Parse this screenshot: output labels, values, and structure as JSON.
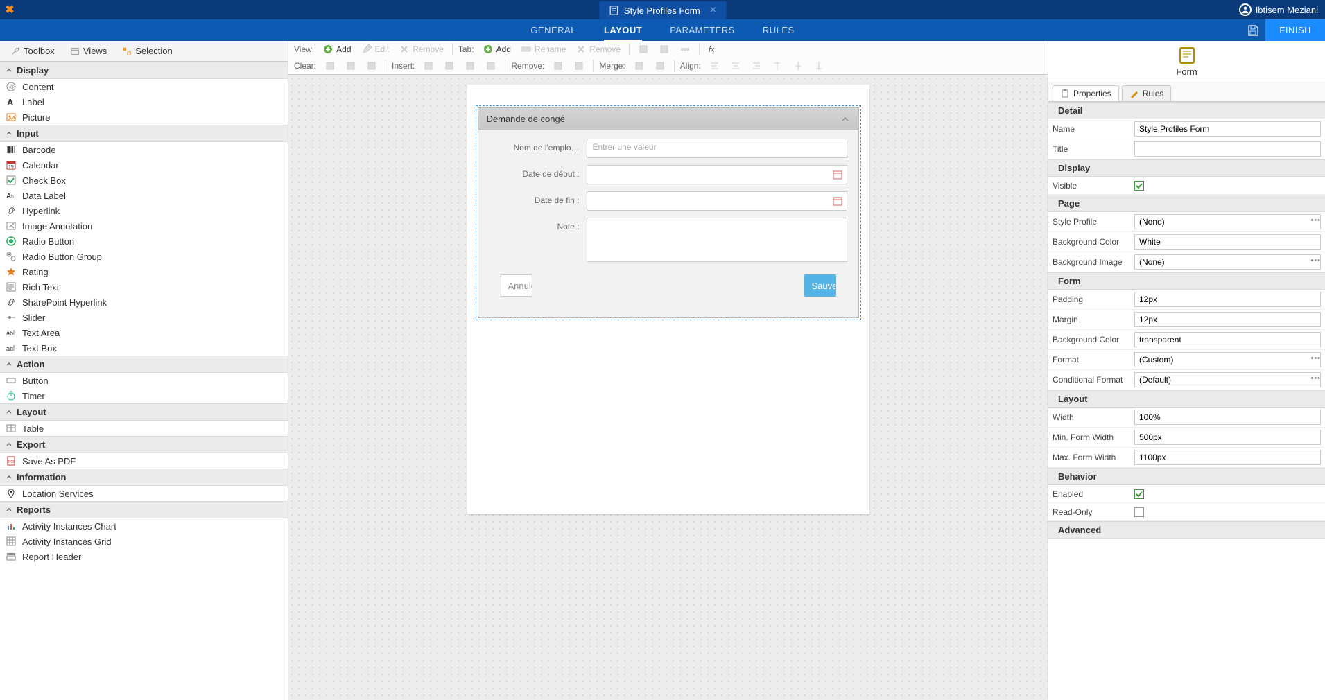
{
  "app": {
    "tab_title": "Style Profiles Form",
    "user_name": "Ibtisem Meziani"
  },
  "nav": {
    "items": [
      "GENERAL",
      "LAYOUT",
      "PARAMETERS",
      "RULES"
    ],
    "active": "LAYOUT",
    "finish": "FINISH"
  },
  "sidebar_tabs": {
    "toolbox": "Toolbox",
    "views": "Views",
    "selection": "Selection"
  },
  "toolbox": {
    "categories": [
      {
        "name": "Display",
        "items": [
          "Content",
          "Label",
          "Picture"
        ]
      },
      {
        "name": "Input",
        "items": [
          "Barcode",
          "Calendar",
          "Check Box",
          "Data Label",
          "Hyperlink",
          "Image Annotation",
          "Radio Button",
          "Radio Button Group",
          "Rating",
          "Rich Text",
          "SharePoint Hyperlink",
          "Slider",
          "Text Area",
          "Text Box"
        ]
      },
      {
        "name": "Action",
        "items": [
          "Button",
          "Timer"
        ]
      },
      {
        "name": "Layout",
        "items": [
          "Table"
        ]
      },
      {
        "name": "Export",
        "items": [
          "Save As PDF"
        ]
      },
      {
        "name": "Information",
        "items": [
          "Location Services"
        ]
      },
      {
        "name": "Reports",
        "items": [
          "Activity Instances Chart",
          "Activity Instances Grid",
          "Report Header"
        ]
      }
    ]
  },
  "canvas_toolbar": {
    "row1": {
      "view": "View:",
      "add": "Add",
      "edit": "Edit",
      "remove": "Remove",
      "tab": "Tab:",
      "tab_add": "Add",
      "tab_rename": "Rename",
      "tab_remove": "Remove"
    },
    "row2": {
      "clear": "Clear:",
      "insert": "Insert:",
      "remove": "Remove:",
      "merge": "Merge:",
      "align": "Align:"
    }
  },
  "form": {
    "title": "Demande de congé",
    "fields": {
      "employee_label": "Nom de l'emplo…",
      "employee_placeholder": "Entrer une valeur",
      "start_label": "Date de début :",
      "end_label": "Date de fin :",
      "note_label": "Note :"
    },
    "cancel": "Annuler",
    "save": "Sauvegarder"
  },
  "props_head": {
    "label": "Form"
  },
  "props_tabs": {
    "properties": "Properties",
    "rules": "Rules"
  },
  "props": {
    "groups": [
      {
        "name": "Detail",
        "rows": [
          {
            "label": "Name",
            "value": "Style Profiles Form",
            "type": "text"
          },
          {
            "label": "Title",
            "value": "",
            "type": "text"
          }
        ]
      },
      {
        "name": "Display",
        "rows": [
          {
            "label": "Visible",
            "value": true,
            "type": "check"
          }
        ]
      },
      {
        "name": "Page",
        "rows": [
          {
            "label": "Style Profile",
            "value": "(None)",
            "type": "text",
            "dots": true
          },
          {
            "label": "Background Color",
            "value": "White",
            "type": "text"
          },
          {
            "label": "Background Image",
            "value": "(None)",
            "type": "text",
            "dots": true
          }
        ]
      },
      {
        "name": "Form",
        "rows": [
          {
            "label": "Padding",
            "value": "12px",
            "type": "text"
          },
          {
            "label": "Margin",
            "value": "12px",
            "type": "text"
          },
          {
            "label": "Background Color",
            "value": "transparent",
            "type": "text"
          },
          {
            "label": "Format",
            "value": "(Custom)",
            "type": "text",
            "dots": true
          },
          {
            "label": "Conditional Format",
            "value": "(Default)",
            "type": "text",
            "dots": true
          }
        ]
      },
      {
        "name": "Layout",
        "rows": [
          {
            "label": "Width",
            "value": "100%",
            "type": "text"
          },
          {
            "label": "Min. Form Width",
            "value": "500px",
            "type": "text"
          },
          {
            "label": "Max. Form Width",
            "value": "1100px",
            "type": "text"
          }
        ]
      },
      {
        "name": "Behavior",
        "rows": [
          {
            "label": "Enabled",
            "value": true,
            "type": "check"
          },
          {
            "label": "Read-Only",
            "value": false,
            "type": "check"
          }
        ]
      },
      {
        "name": "Advanced",
        "rows": []
      }
    ]
  }
}
